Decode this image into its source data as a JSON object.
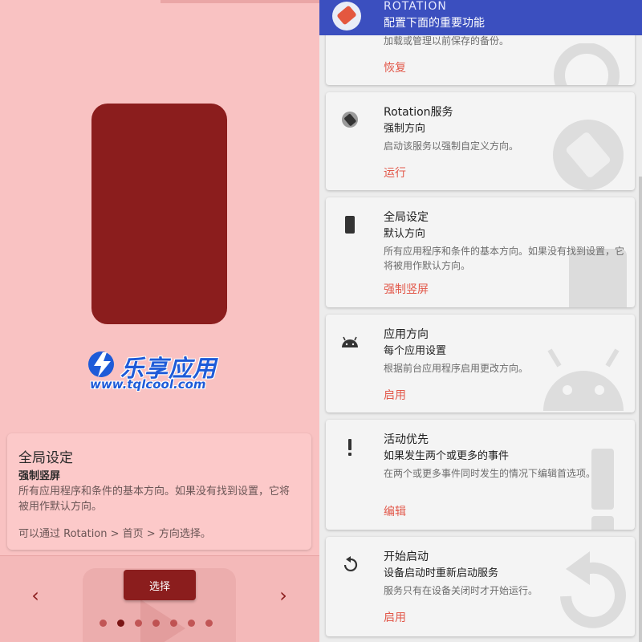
{
  "left": {
    "logo": {
      "name_cn": "乐享应用",
      "url": "www.tqlcool.com"
    },
    "info_card": {
      "title": "全局设定",
      "subtitle": "强制竖屏",
      "description": "所有应用程序和条件的基本方向。如果没有找到设置，它将被用作默认方向。",
      "hint": "可以通过 Rotation > 首页 > 方向选择。"
    },
    "bottom": {
      "select_label": "选择",
      "prev_icon": "‹",
      "next_icon": "›",
      "page_count": 7,
      "active_page": 2
    },
    "colors": {
      "accent": "#8b1d1d",
      "background": "#f9c2c2"
    }
  },
  "right": {
    "appbar": {
      "title": "ROTATION",
      "subtitle": "配置下面的重要功能",
      "color": "#3b4fbf"
    },
    "top_card": {
      "description": "加载或管理以前保存的备份。",
      "action": "恢复"
    },
    "cards": [
      {
        "icon": "rotation-service-icon",
        "title": "Rotation服务",
        "subtitle": "强制方向",
        "description": "启动该服务以强制自定义方向。",
        "action": "运行"
      },
      {
        "icon": "phone-portrait-icon",
        "title": "全局设定",
        "subtitle": "默认方向",
        "description": "所有应用程序和条件的基本方向。如果没有找到设置，它将被用作默认方向。",
        "action": "强制竖屏"
      },
      {
        "icon": "android-icon",
        "title": "应用方向",
        "subtitle": "每个应用设置",
        "description": "根据前台应用程序启用更改方向。",
        "action": "启用"
      },
      {
        "icon": "exclamation-icon",
        "title": "活动优先",
        "subtitle": "如果发生两个或更多的事件",
        "description": "在两个或更多事件同时发生的情况下编辑首选项。",
        "action": "编辑"
      },
      {
        "icon": "restart-icon",
        "title": "开始启动",
        "subtitle": "设备启动时重新启动服务",
        "description": "服务只有在设备关闭时才开始运行。",
        "action": "启用"
      }
    ],
    "colors": {
      "action": "#e2584a"
    }
  }
}
